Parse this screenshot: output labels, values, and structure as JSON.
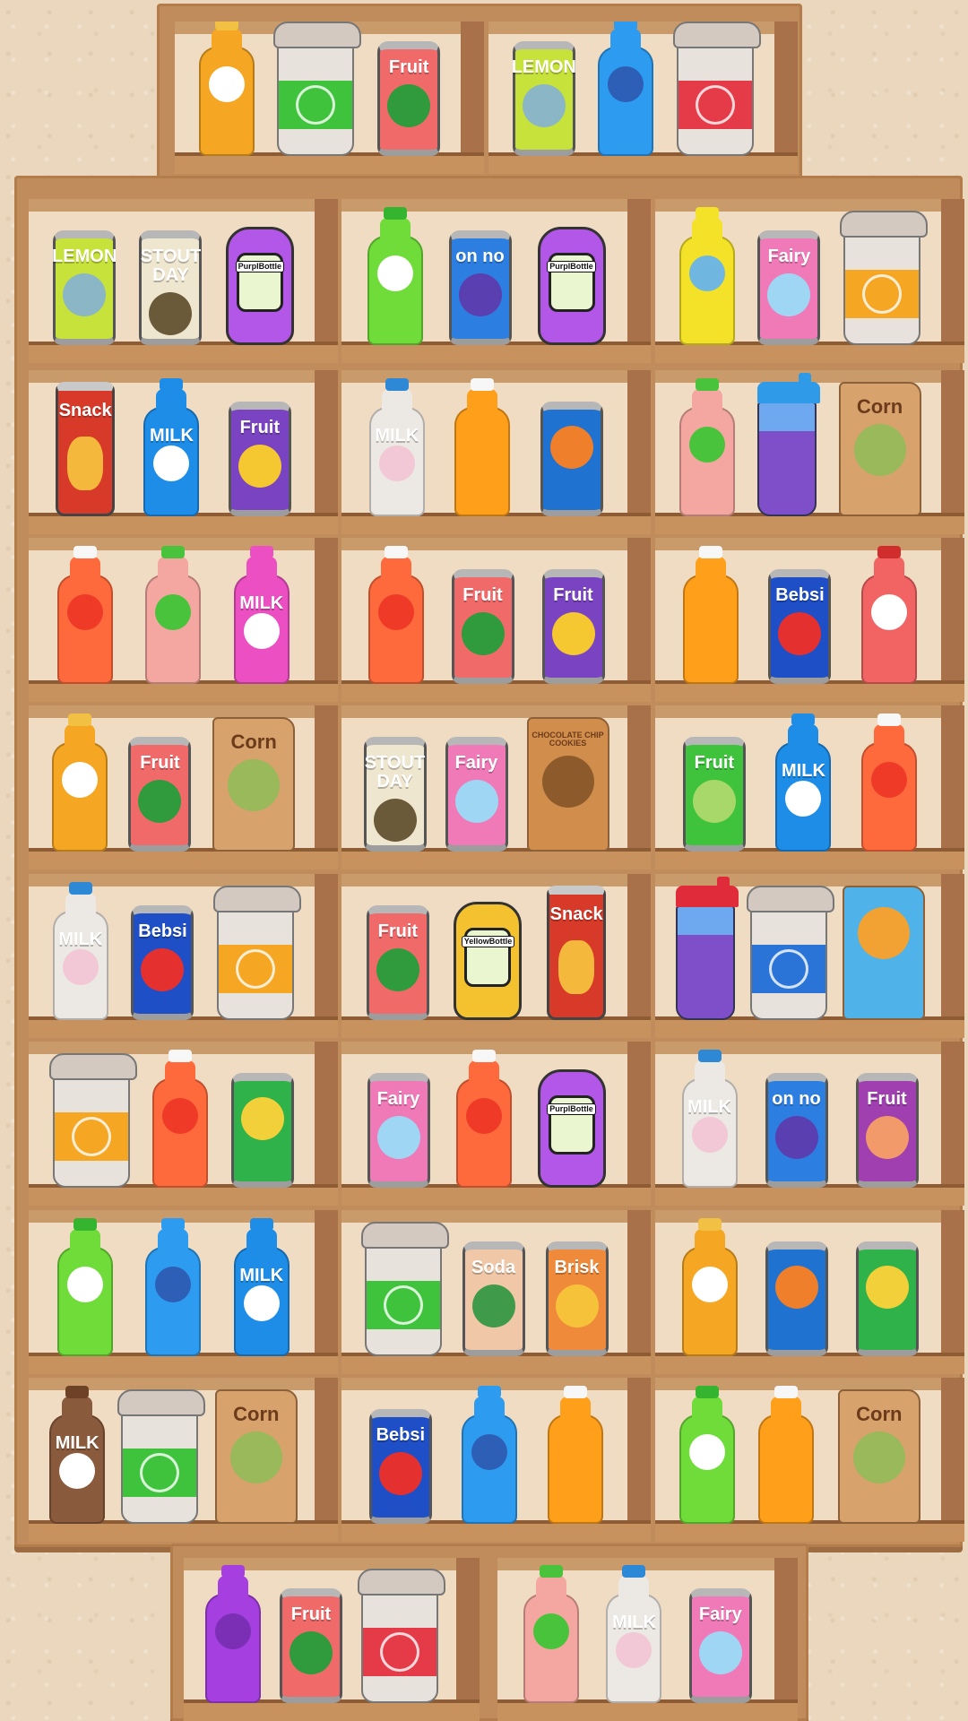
{
  "shelves": [
    {
      "items": [
        {
          "kind": "bottle",
          "body": "#f5a623",
          "cap": "#f2c043",
          "pic": "#ffffff",
          "label": ""
        },
        {
          "kind": "cup",
          "sleeve": "#3fc33d"
        },
        {
          "kind": "can",
          "body": "#f06a6a",
          "pic": "#2f9b3c",
          "label": "Fruit"
        }
      ]
    },
    {
      "items": [
        {
          "kind": "can",
          "body": "#c7e23a",
          "pic": "#8ab6c5",
          "label": "LEMON"
        },
        {
          "kind": "bottle",
          "body": "#2d9bf0",
          "cap": "#2d9bf0",
          "pic": "#2e5fb7",
          "label": ""
        },
        {
          "kind": "cup",
          "sleeve": "#e53b48"
        }
      ]
    },
    {
      "items": [
        {
          "kind": "can",
          "body": "#c7e23a",
          "pic": "#8ab6c5",
          "label": "LEMON"
        },
        {
          "kind": "can",
          "body": "#efe6cf",
          "pic": "#6b5a3a",
          "label": "STOUT DAY"
        },
        {
          "kind": "jug",
          "body": "#b257e8",
          "label": "PurplBottle"
        }
      ]
    },
    {
      "items": [
        {
          "kind": "bottle",
          "body": "#6fdc3a",
          "cap": "#35b52f",
          "pic": "#ffffff",
          "label": ""
        },
        {
          "kind": "can",
          "body": "#2c7fe0",
          "pic": "#5a3fb0",
          "label": "on no"
        },
        {
          "kind": "jug",
          "body": "#b257e8",
          "label": "PurplBottle"
        }
      ]
    },
    {
      "items": [
        {
          "kind": "bottle",
          "body": "#f3e227",
          "cap": "#f3e227",
          "pic": "#6fb6e0",
          "label": ""
        },
        {
          "kind": "can",
          "body": "#f07ab8",
          "pic": "#9fd6f4",
          "label": "Fairy"
        },
        {
          "kind": "cup",
          "sleeve": "#f5a623"
        }
      ]
    },
    {
      "items": [
        {
          "kind": "tube",
          "body": "#d83a2a",
          "label": "Snack"
        },
        {
          "kind": "bottle",
          "body": "#1e8de8",
          "cap": "#1e8de8",
          "pic": "#ffffff",
          "label": "MILK"
        },
        {
          "kind": "can",
          "body": "#7a43c2",
          "pic": "#f5c730",
          "label": "Fruit"
        }
      ]
    },
    {
      "items": [
        {
          "kind": "bottle",
          "body": "#ece9e4",
          "cap": "#2d88d6",
          "pic": "#f2c7d6",
          "label": "MILK"
        },
        {
          "kind": "bottle",
          "body": "#ff9f1a",
          "cap": "#f7f7f7",
          "pic": "#ff9f1a",
          "label": ""
        },
        {
          "kind": "can",
          "body": "#1f72cf",
          "pic": "#ef7f2a",
          "label": ""
        }
      ]
    },
    {
      "items": [
        {
          "kind": "bottle",
          "body": "#f3a7a0",
          "cap": "#49c33b",
          "pic": "#49c33b",
          "label": ""
        },
        {
          "kind": "shaker",
          "body": "#7e4fc8",
          "top": "#2f9ae8"
        },
        {
          "kind": "bag",
          "body": "#d8a26d",
          "pic": "#99b95a",
          "label": "Corn"
        }
      ]
    },
    {
      "items": [
        {
          "kind": "bottle",
          "body": "#ff6a3d",
          "cap": "#f7f7f7",
          "pic": "#ef3a28",
          "label": ""
        },
        {
          "kind": "bottle",
          "body": "#f3a7a0",
          "cap": "#49c33b",
          "pic": "#49c33b",
          "label": ""
        },
        {
          "kind": "bottle",
          "body": "#ec4fc2",
          "cap": "#ec4fc2",
          "pic": "#ffffff",
          "label": "MILK"
        }
      ]
    },
    {
      "items": [
        {
          "kind": "bottle",
          "body": "#ff6a3d",
          "cap": "#f7f7f7",
          "pic": "#ef3a28",
          "label": ""
        },
        {
          "kind": "can",
          "body": "#f06a6a",
          "pic": "#2f9b3c",
          "label": "Fruit"
        },
        {
          "kind": "can",
          "body": "#7a43c2",
          "pic": "#f5c730",
          "label": "Fruit"
        }
      ]
    },
    {
      "items": [
        {
          "kind": "bottle",
          "body": "#ff9f1a",
          "cap": "#f7f7f7",
          "pic": "#ff9f1a",
          "label": ""
        },
        {
          "kind": "can",
          "body": "#1f4fc7",
          "pic": "#e53030",
          "label": "Bebsi"
        },
        {
          "kind": "bottle",
          "body": "#f26464",
          "cap": "#d12d2d",
          "pic": "#ffffff",
          "label": ""
        }
      ]
    },
    {
      "items": [
        {
          "kind": "bottle",
          "body": "#f5a623",
          "cap": "#f2c043",
          "pic": "#ffffff",
          "label": ""
        },
        {
          "kind": "can",
          "body": "#f06a6a",
          "pic": "#2f9b3c",
          "label": "Fruit"
        },
        {
          "kind": "bag",
          "body": "#d8a26d",
          "pic": "#99b95a",
          "label": "Corn"
        }
      ]
    },
    {
      "items": [
        {
          "kind": "can",
          "body": "#efe6cf",
          "pic": "#6b5a3a",
          "label": "STOUT DAY"
        },
        {
          "kind": "can",
          "body": "#f07ab8",
          "pic": "#9fd6f4",
          "label": "Fairy"
        },
        {
          "kind": "bag",
          "body": "#d08d4b",
          "pic": "#8d5a2b",
          "label": "CHOCOLATE CHIP COOKIES"
        }
      ]
    },
    {
      "items": [
        {
          "kind": "can",
          "body": "#3fc33d",
          "pic": "#a8d86a",
          "label": "Fruit"
        },
        {
          "kind": "bottle",
          "body": "#1e8de8",
          "cap": "#1e8de8",
          "pic": "#ffffff",
          "label": "MILK"
        },
        {
          "kind": "bottle",
          "body": "#ff6a3d",
          "cap": "#f7f7f7",
          "pic": "#ef3a28",
          "label": ""
        }
      ]
    },
    {
      "items": [
        {
          "kind": "bottle",
          "body": "#ece9e4",
          "cap": "#2d88d6",
          "pic": "#f2c7d6",
          "label": "MILK"
        },
        {
          "kind": "can",
          "body": "#1f4fc7",
          "pic": "#e53030",
          "label": "Bebsi"
        },
        {
          "kind": "cup",
          "sleeve": "#f5a623"
        }
      ]
    },
    {
      "items": [
        {
          "kind": "can",
          "body": "#f06a6a",
          "pic": "#2f9b3c",
          "label": "Fruit"
        },
        {
          "kind": "jug",
          "body": "#f5c22f",
          "label": "YellowBottle"
        },
        {
          "kind": "tube",
          "body": "#d83a2a",
          "label": "Snack"
        }
      ]
    },
    {
      "items": [
        {
          "kind": "shaker",
          "body": "#7e4fc8",
          "top": "#e02b3a"
        },
        {
          "kind": "cup",
          "sleeve": "#2a74d8"
        },
        {
          "kind": "bag",
          "body": "#4fb2e8",
          "pic": "#f2a233",
          "label": ""
        }
      ]
    },
    {
      "items": [
        {
          "kind": "cup",
          "sleeve": "#f5a623"
        },
        {
          "kind": "bottle",
          "body": "#ff6a3d",
          "cap": "#f7f7f7",
          "pic": "#ef3a28",
          "label": ""
        },
        {
          "kind": "can",
          "body": "#2fb24a",
          "pic": "#f2d03a",
          "label": ""
        }
      ]
    },
    {
      "items": [
        {
          "kind": "can",
          "body": "#f07ab8",
          "pic": "#9fd6f4",
          "label": "Fairy"
        },
        {
          "kind": "bottle",
          "body": "#ff6a3d",
          "cap": "#f7f7f7",
          "pic": "#ef3a28",
          "label": ""
        },
        {
          "kind": "jug",
          "body": "#b257e8",
          "label": "PurplBottle"
        }
      ]
    },
    {
      "items": [
        {
          "kind": "bottle",
          "body": "#ece9e4",
          "cap": "#2d88d6",
          "pic": "#f2c7d6",
          "label": "MILK"
        },
        {
          "kind": "can",
          "body": "#2c7fe0",
          "pic": "#5a3fb0",
          "label": "on no"
        },
        {
          "kind": "can",
          "body": "#a03fb0",
          "pic": "#f29a6a",
          "label": "Fruit"
        }
      ]
    },
    {
      "items": [
        {
          "kind": "bottle",
          "body": "#6fdc3a",
          "cap": "#35b52f",
          "pic": "#ffffff",
          "label": ""
        },
        {
          "kind": "bottle",
          "body": "#2d9bf0",
          "cap": "#2d9bf0",
          "pic": "#2e5fb7",
          "label": ""
        },
        {
          "kind": "bottle",
          "body": "#1e8de8",
          "cap": "#1e8de8",
          "pic": "#ffffff",
          "label": "MILK"
        }
      ]
    },
    {
      "items": [
        {
          "kind": "cup",
          "sleeve": "#3fc33d"
        },
        {
          "kind": "can",
          "body": "#f0c8a8",
          "pic": "#3f9a4a",
          "label": "Soda"
        },
        {
          "kind": "can",
          "body": "#ef8a3a",
          "pic": "#f5c23a",
          "label": "Brisk"
        }
      ]
    },
    {
      "items": [
        {
          "kind": "bottle",
          "body": "#f5a623",
          "cap": "#f2c043",
          "pic": "#ffffff",
          "label": ""
        },
        {
          "kind": "can",
          "body": "#1f72cf",
          "pic": "#ef7f2a",
          "label": ""
        },
        {
          "kind": "can",
          "body": "#2fb24a",
          "pic": "#f2d03a",
          "label": ""
        }
      ]
    },
    {
      "items": [
        {
          "kind": "bottle",
          "body": "#8a5a3c",
          "cap": "#6e4226",
          "pic": "#ffffff",
          "label": "MILK"
        },
        {
          "kind": "cup",
          "sleeve": "#3fc33d"
        },
        {
          "kind": "bag",
          "body": "#d8a26d",
          "pic": "#99b95a",
          "label": "Corn"
        }
      ]
    },
    {
      "items": [
        {
          "kind": "can",
          "body": "#1f4fc7",
          "pic": "#e53030",
          "label": "Bebsi"
        },
        {
          "kind": "bottle",
          "body": "#2d9bf0",
          "cap": "#2d9bf0",
          "pic": "#2e5fb7",
          "label": ""
        },
        {
          "kind": "bottle",
          "body": "#ff9f1a",
          "cap": "#f7f7f7",
          "pic": "#ff9f1a",
          "label": ""
        }
      ]
    },
    {
      "items": [
        {
          "kind": "bottle",
          "body": "#6fdc3a",
          "cap": "#35b52f",
          "pic": "#ffffff",
          "label": ""
        },
        {
          "kind": "bottle",
          "body": "#ff9f1a",
          "cap": "#f7f7f7",
          "pic": "#ff9f1a",
          "label": ""
        },
        {
          "kind": "bag",
          "body": "#d8a26d",
          "pic": "#99b95a",
          "label": "Corn"
        }
      ]
    },
    {
      "items": [
        {
          "kind": "bottle",
          "body": "#a63fe0",
          "cap": "#a63fe0",
          "pic": "#7a2fb5",
          "label": ""
        },
        {
          "kind": "can",
          "body": "#f06a6a",
          "pic": "#2f9b3c",
          "label": "Fruit"
        },
        {
          "kind": "cup",
          "sleeve": "#e53b48"
        }
      ]
    },
    {
      "items": [
        {
          "kind": "bottle",
          "body": "#f3a7a0",
          "cap": "#49c33b",
          "pic": "#49c33b",
          "label": ""
        },
        {
          "kind": "bottle",
          "body": "#ece9e4",
          "cap": "#2d88d6",
          "pic": "#f2c7d6",
          "label": "MILK"
        },
        {
          "kind": "can",
          "body": "#f07ab8",
          "pic": "#9fd6f4",
          "label": "Fairy"
        }
      ]
    }
  ]
}
